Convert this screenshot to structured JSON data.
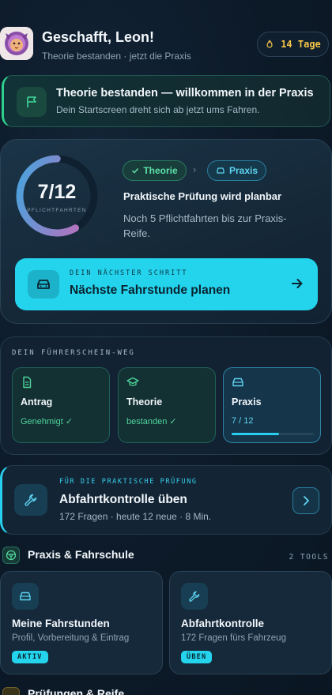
{
  "header": {
    "greeting": "Geschafft, Leon!",
    "subtitle": "Theorie bestanden · jetzt die Praxis",
    "streak": "14 Tage",
    "streak_icon": "flame-icon"
  },
  "banner": {
    "title": "Theorie bestanden — willkommen in der Praxis",
    "subtitle": "Dein Startscreen dreht sich ab jetzt ums Fahren.",
    "icon": "flag-icon"
  },
  "progress": {
    "value": "7/12",
    "label": "PFLICHTFAHRTEN",
    "completed": 7,
    "total": 12,
    "chip_theory": "Theorie",
    "chip_praxis": "Praxis",
    "title": "Praktische Prüfung wird planbar",
    "subtitle": "Noch 5 Pflichtfahrten bis zur Praxis-Reife.",
    "cta_kicker": "DEIN NÄCHSTER SCHRITT",
    "cta_title": "Nächste Fahrstunde planen"
  },
  "journey": {
    "title": "DEIN FÜHRERSCHEIN-WEG",
    "steps": [
      {
        "name": "Antrag",
        "status": "Genehmigt ✓",
        "icon": "document-icon"
      },
      {
        "name": "Theorie",
        "status": "bestanden ✓",
        "icon": "graduation-cap-icon"
      },
      {
        "name": "Praxis",
        "status": "7 / 12",
        "icon": "car-icon",
        "progress": 0.58
      }
    ]
  },
  "practice": {
    "kicker": "FÜR DIE PRAKTISCHE PRÜFUNG",
    "title": "Abfahrtkontrolle üben",
    "subtitle": "172 Fragen · heute 12 neue · 8 Min.",
    "icon": "wrench-icon"
  },
  "section": {
    "title": "Praxis & Fahrschule",
    "count": "2 TOOLS",
    "icon": "steering-wheel-icon",
    "tools": [
      {
        "title": "Meine Fahrstunden",
        "subtitle": "Profil, Vorbereitung & Eintrag",
        "badge": "AKTIV",
        "icon": "car-icon"
      },
      {
        "title": "Abfahrtkontrolle",
        "subtitle": "172 Fragen fürs Fahrzeug",
        "badge": "ÜBEN",
        "icon": "wrench-icon"
      }
    ]
  },
  "next_section": {
    "title": "Prüfungen & Reife"
  },
  "colors": {
    "accent": "#24d3ec",
    "success": "#2fcf8e",
    "streak": "#f4c348",
    "ring_start": "#d464b6",
    "ring_end": "#3da8e0"
  }
}
